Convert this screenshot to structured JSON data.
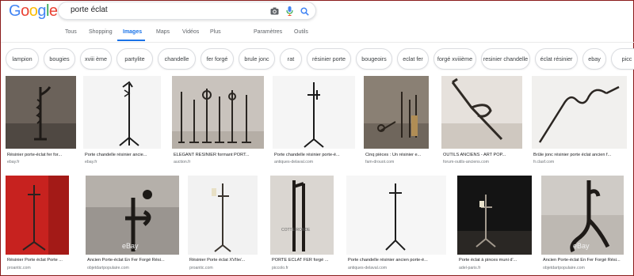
{
  "search": {
    "query": "porte éclat"
  },
  "tabs": [
    {
      "label": "Tous"
    },
    {
      "label": "Shopping"
    },
    {
      "label": "Images"
    },
    {
      "label": "Maps"
    },
    {
      "label": "Vidéos"
    },
    {
      "label": "Plus"
    },
    {
      "label": "Paramètres"
    },
    {
      "label": "Outils"
    }
  ],
  "chips": [
    "lampion",
    "bougies",
    "xviii ème",
    "partylite",
    "chandelle",
    "fer forgé",
    "brule jonc",
    "rat",
    "résinier porte",
    "bougeoirs",
    "eclat fer",
    "forgé xviiième",
    "resinier chandelle",
    "éclat résinier",
    "ebay",
    "picc"
  ],
  "row1": [
    {
      "caption": "Résinier porte-éclat fer for...",
      "source": "ebay.fr"
    },
    {
      "caption": "Porte chandelle résinier ancie...",
      "source": "ebay.fr"
    },
    {
      "caption": "ELEGANT RESINIER formant PORT...",
      "source": "auction.fr"
    },
    {
      "caption": "Porte chandelle résinier porte-é...",
      "source": "antiques-delaval.com"
    },
    {
      "caption": "Cinq pièces : Un résinier e...",
      "source": "fam-drouot.com"
    },
    {
      "caption": "OUTILS ANCIENS - ART POP...",
      "source": "forum-outils-anciens.com"
    },
    {
      "caption": "Brûle jonc résinier porte éclat ancien f...",
      "source": "fr.clasf.com"
    }
  ],
  "row2": [
    {
      "caption": "Résinier Porte éclat Porte ...",
      "source": "proantic.com"
    },
    {
      "caption": "Ancien Porte-éclat En Fer Forgé Rési...",
      "source": "objetdartpopulaire.com",
      "watermark": "eBay"
    },
    {
      "caption": "Résinier Porte éclat XVIIe/...",
      "source": "proantic.com"
    },
    {
      "caption": "PORTE ÉCLAT FER forgé ...",
      "source": "piccolo.fr",
      "watermark": "COTTE RONDE"
    },
    {
      "caption": "Porte chandelle résinier ancien porte-é...",
      "source": "antiques-delaval.com"
    },
    {
      "caption": "Porte éclat à pinces muni d'...",
      "source": "adel-paris.fr"
    },
    {
      "caption": "Ancien Porte-éclat En Fer Forgé Rési...",
      "source": "objetdartpopulaire.com",
      "watermark": "eBay"
    }
  ],
  "colors": {
    "accent": "#1a73e8",
    "logo_blue": "#4285f4",
    "logo_red": "#ea4335",
    "logo_yellow": "#fbbc05",
    "logo_green": "#34a853"
  },
  "icons": [
    "camera-icon",
    "microphone-icon",
    "search-icon"
  ]
}
